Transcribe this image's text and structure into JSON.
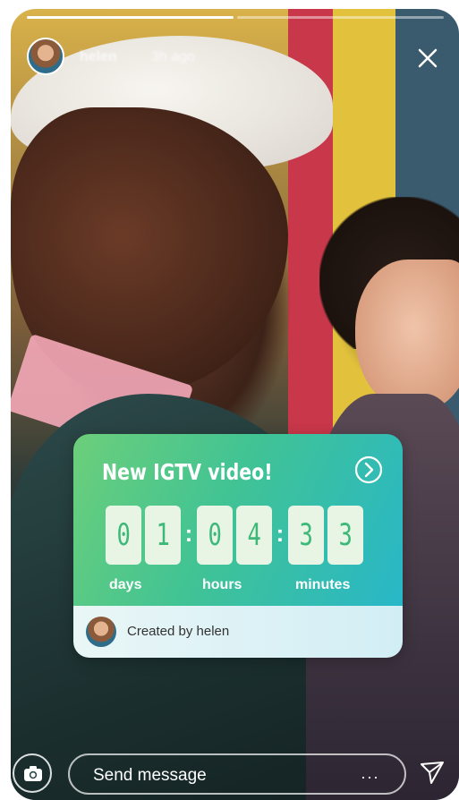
{
  "header": {
    "username": "helen",
    "timestamp": "3h ago"
  },
  "progress": [
    1.0,
    0.0
  ],
  "sticker": {
    "title": "New IGTV video!",
    "digits": [
      "0",
      "1",
      "0",
      "4",
      "3",
      "3"
    ],
    "separator": ":",
    "units": [
      "days",
      "hours",
      "minutes"
    ],
    "creator": "Created by helen",
    "colors": {
      "gradient_start": "#6ccf7a",
      "gradient_end": "#28b7c8",
      "digit_text": "#3cb878"
    }
  },
  "footer": {
    "message_placeholder": "Send message",
    "more": "···"
  },
  "icons": [
    "close-icon",
    "chevron-right-icon",
    "camera-icon",
    "send-icon",
    "more-icon"
  ]
}
